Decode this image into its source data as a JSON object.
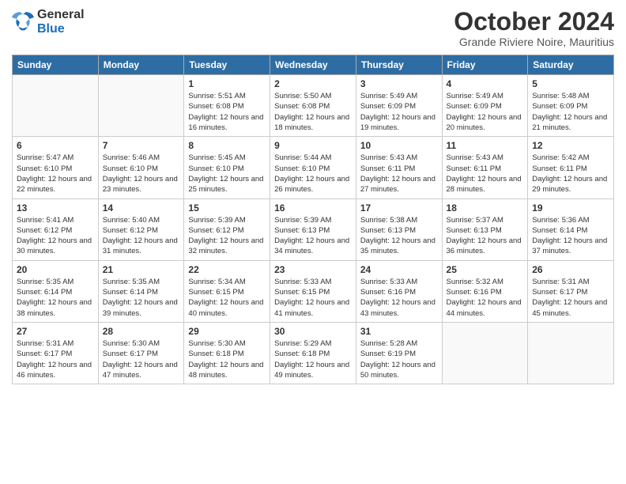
{
  "logo": {
    "general": "General",
    "blue": "Blue"
  },
  "header": {
    "month": "October 2024",
    "location": "Grande Riviere Noire, Mauritius"
  },
  "days_of_week": [
    "Sunday",
    "Monday",
    "Tuesday",
    "Wednesday",
    "Thursday",
    "Friday",
    "Saturday"
  ],
  "weeks": [
    [
      {
        "day": "",
        "sunrise": "",
        "sunset": "",
        "daylight": ""
      },
      {
        "day": "",
        "sunrise": "",
        "sunset": "",
        "daylight": ""
      },
      {
        "day": "1",
        "sunrise": "Sunrise: 5:51 AM",
        "sunset": "Sunset: 6:08 PM",
        "daylight": "Daylight: 12 hours and 16 minutes."
      },
      {
        "day": "2",
        "sunrise": "Sunrise: 5:50 AM",
        "sunset": "Sunset: 6:08 PM",
        "daylight": "Daylight: 12 hours and 18 minutes."
      },
      {
        "day": "3",
        "sunrise": "Sunrise: 5:49 AM",
        "sunset": "Sunset: 6:09 PM",
        "daylight": "Daylight: 12 hours and 19 minutes."
      },
      {
        "day": "4",
        "sunrise": "Sunrise: 5:49 AM",
        "sunset": "Sunset: 6:09 PM",
        "daylight": "Daylight: 12 hours and 20 minutes."
      },
      {
        "day": "5",
        "sunrise": "Sunrise: 5:48 AM",
        "sunset": "Sunset: 6:09 PM",
        "daylight": "Daylight: 12 hours and 21 minutes."
      }
    ],
    [
      {
        "day": "6",
        "sunrise": "Sunrise: 5:47 AM",
        "sunset": "Sunset: 6:10 PM",
        "daylight": "Daylight: 12 hours and 22 minutes."
      },
      {
        "day": "7",
        "sunrise": "Sunrise: 5:46 AM",
        "sunset": "Sunset: 6:10 PM",
        "daylight": "Daylight: 12 hours and 23 minutes."
      },
      {
        "day": "8",
        "sunrise": "Sunrise: 5:45 AM",
        "sunset": "Sunset: 6:10 PM",
        "daylight": "Daylight: 12 hours and 25 minutes."
      },
      {
        "day": "9",
        "sunrise": "Sunrise: 5:44 AM",
        "sunset": "Sunset: 6:10 PM",
        "daylight": "Daylight: 12 hours and 26 minutes."
      },
      {
        "day": "10",
        "sunrise": "Sunrise: 5:43 AM",
        "sunset": "Sunset: 6:11 PM",
        "daylight": "Daylight: 12 hours and 27 minutes."
      },
      {
        "day": "11",
        "sunrise": "Sunrise: 5:43 AM",
        "sunset": "Sunset: 6:11 PM",
        "daylight": "Daylight: 12 hours and 28 minutes."
      },
      {
        "day": "12",
        "sunrise": "Sunrise: 5:42 AM",
        "sunset": "Sunset: 6:11 PM",
        "daylight": "Daylight: 12 hours and 29 minutes."
      }
    ],
    [
      {
        "day": "13",
        "sunrise": "Sunrise: 5:41 AM",
        "sunset": "Sunset: 6:12 PM",
        "daylight": "Daylight: 12 hours and 30 minutes."
      },
      {
        "day": "14",
        "sunrise": "Sunrise: 5:40 AM",
        "sunset": "Sunset: 6:12 PM",
        "daylight": "Daylight: 12 hours and 31 minutes."
      },
      {
        "day": "15",
        "sunrise": "Sunrise: 5:39 AM",
        "sunset": "Sunset: 6:12 PM",
        "daylight": "Daylight: 12 hours and 32 minutes."
      },
      {
        "day": "16",
        "sunrise": "Sunrise: 5:39 AM",
        "sunset": "Sunset: 6:13 PM",
        "daylight": "Daylight: 12 hours and 34 minutes."
      },
      {
        "day": "17",
        "sunrise": "Sunrise: 5:38 AM",
        "sunset": "Sunset: 6:13 PM",
        "daylight": "Daylight: 12 hours and 35 minutes."
      },
      {
        "day": "18",
        "sunrise": "Sunrise: 5:37 AM",
        "sunset": "Sunset: 6:13 PM",
        "daylight": "Daylight: 12 hours and 36 minutes."
      },
      {
        "day": "19",
        "sunrise": "Sunrise: 5:36 AM",
        "sunset": "Sunset: 6:14 PM",
        "daylight": "Daylight: 12 hours and 37 minutes."
      }
    ],
    [
      {
        "day": "20",
        "sunrise": "Sunrise: 5:35 AM",
        "sunset": "Sunset: 6:14 PM",
        "daylight": "Daylight: 12 hours and 38 minutes."
      },
      {
        "day": "21",
        "sunrise": "Sunrise: 5:35 AM",
        "sunset": "Sunset: 6:14 PM",
        "daylight": "Daylight: 12 hours and 39 minutes."
      },
      {
        "day": "22",
        "sunrise": "Sunrise: 5:34 AM",
        "sunset": "Sunset: 6:15 PM",
        "daylight": "Daylight: 12 hours and 40 minutes."
      },
      {
        "day": "23",
        "sunrise": "Sunrise: 5:33 AM",
        "sunset": "Sunset: 6:15 PM",
        "daylight": "Daylight: 12 hours and 41 minutes."
      },
      {
        "day": "24",
        "sunrise": "Sunrise: 5:33 AM",
        "sunset": "Sunset: 6:16 PM",
        "daylight": "Daylight: 12 hours and 43 minutes."
      },
      {
        "day": "25",
        "sunrise": "Sunrise: 5:32 AM",
        "sunset": "Sunset: 6:16 PM",
        "daylight": "Daylight: 12 hours and 44 minutes."
      },
      {
        "day": "26",
        "sunrise": "Sunrise: 5:31 AM",
        "sunset": "Sunset: 6:17 PM",
        "daylight": "Daylight: 12 hours and 45 minutes."
      }
    ],
    [
      {
        "day": "27",
        "sunrise": "Sunrise: 5:31 AM",
        "sunset": "Sunset: 6:17 PM",
        "daylight": "Daylight: 12 hours and 46 minutes."
      },
      {
        "day": "28",
        "sunrise": "Sunrise: 5:30 AM",
        "sunset": "Sunset: 6:17 PM",
        "daylight": "Daylight: 12 hours and 47 minutes."
      },
      {
        "day": "29",
        "sunrise": "Sunrise: 5:30 AM",
        "sunset": "Sunset: 6:18 PM",
        "daylight": "Daylight: 12 hours and 48 minutes."
      },
      {
        "day": "30",
        "sunrise": "Sunrise: 5:29 AM",
        "sunset": "Sunset: 6:18 PM",
        "daylight": "Daylight: 12 hours and 49 minutes."
      },
      {
        "day": "31",
        "sunrise": "Sunrise: 5:28 AM",
        "sunset": "Sunset: 6:19 PM",
        "daylight": "Daylight: 12 hours and 50 minutes."
      },
      {
        "day": "",
        "sunrise": "",
        "sunset": "",
        "daylight": ""
      },
      {
        "day": "",
        "sunrise": "",
        "sunset": "",
        "daylight": ""
      }
    ]
  ]
}
